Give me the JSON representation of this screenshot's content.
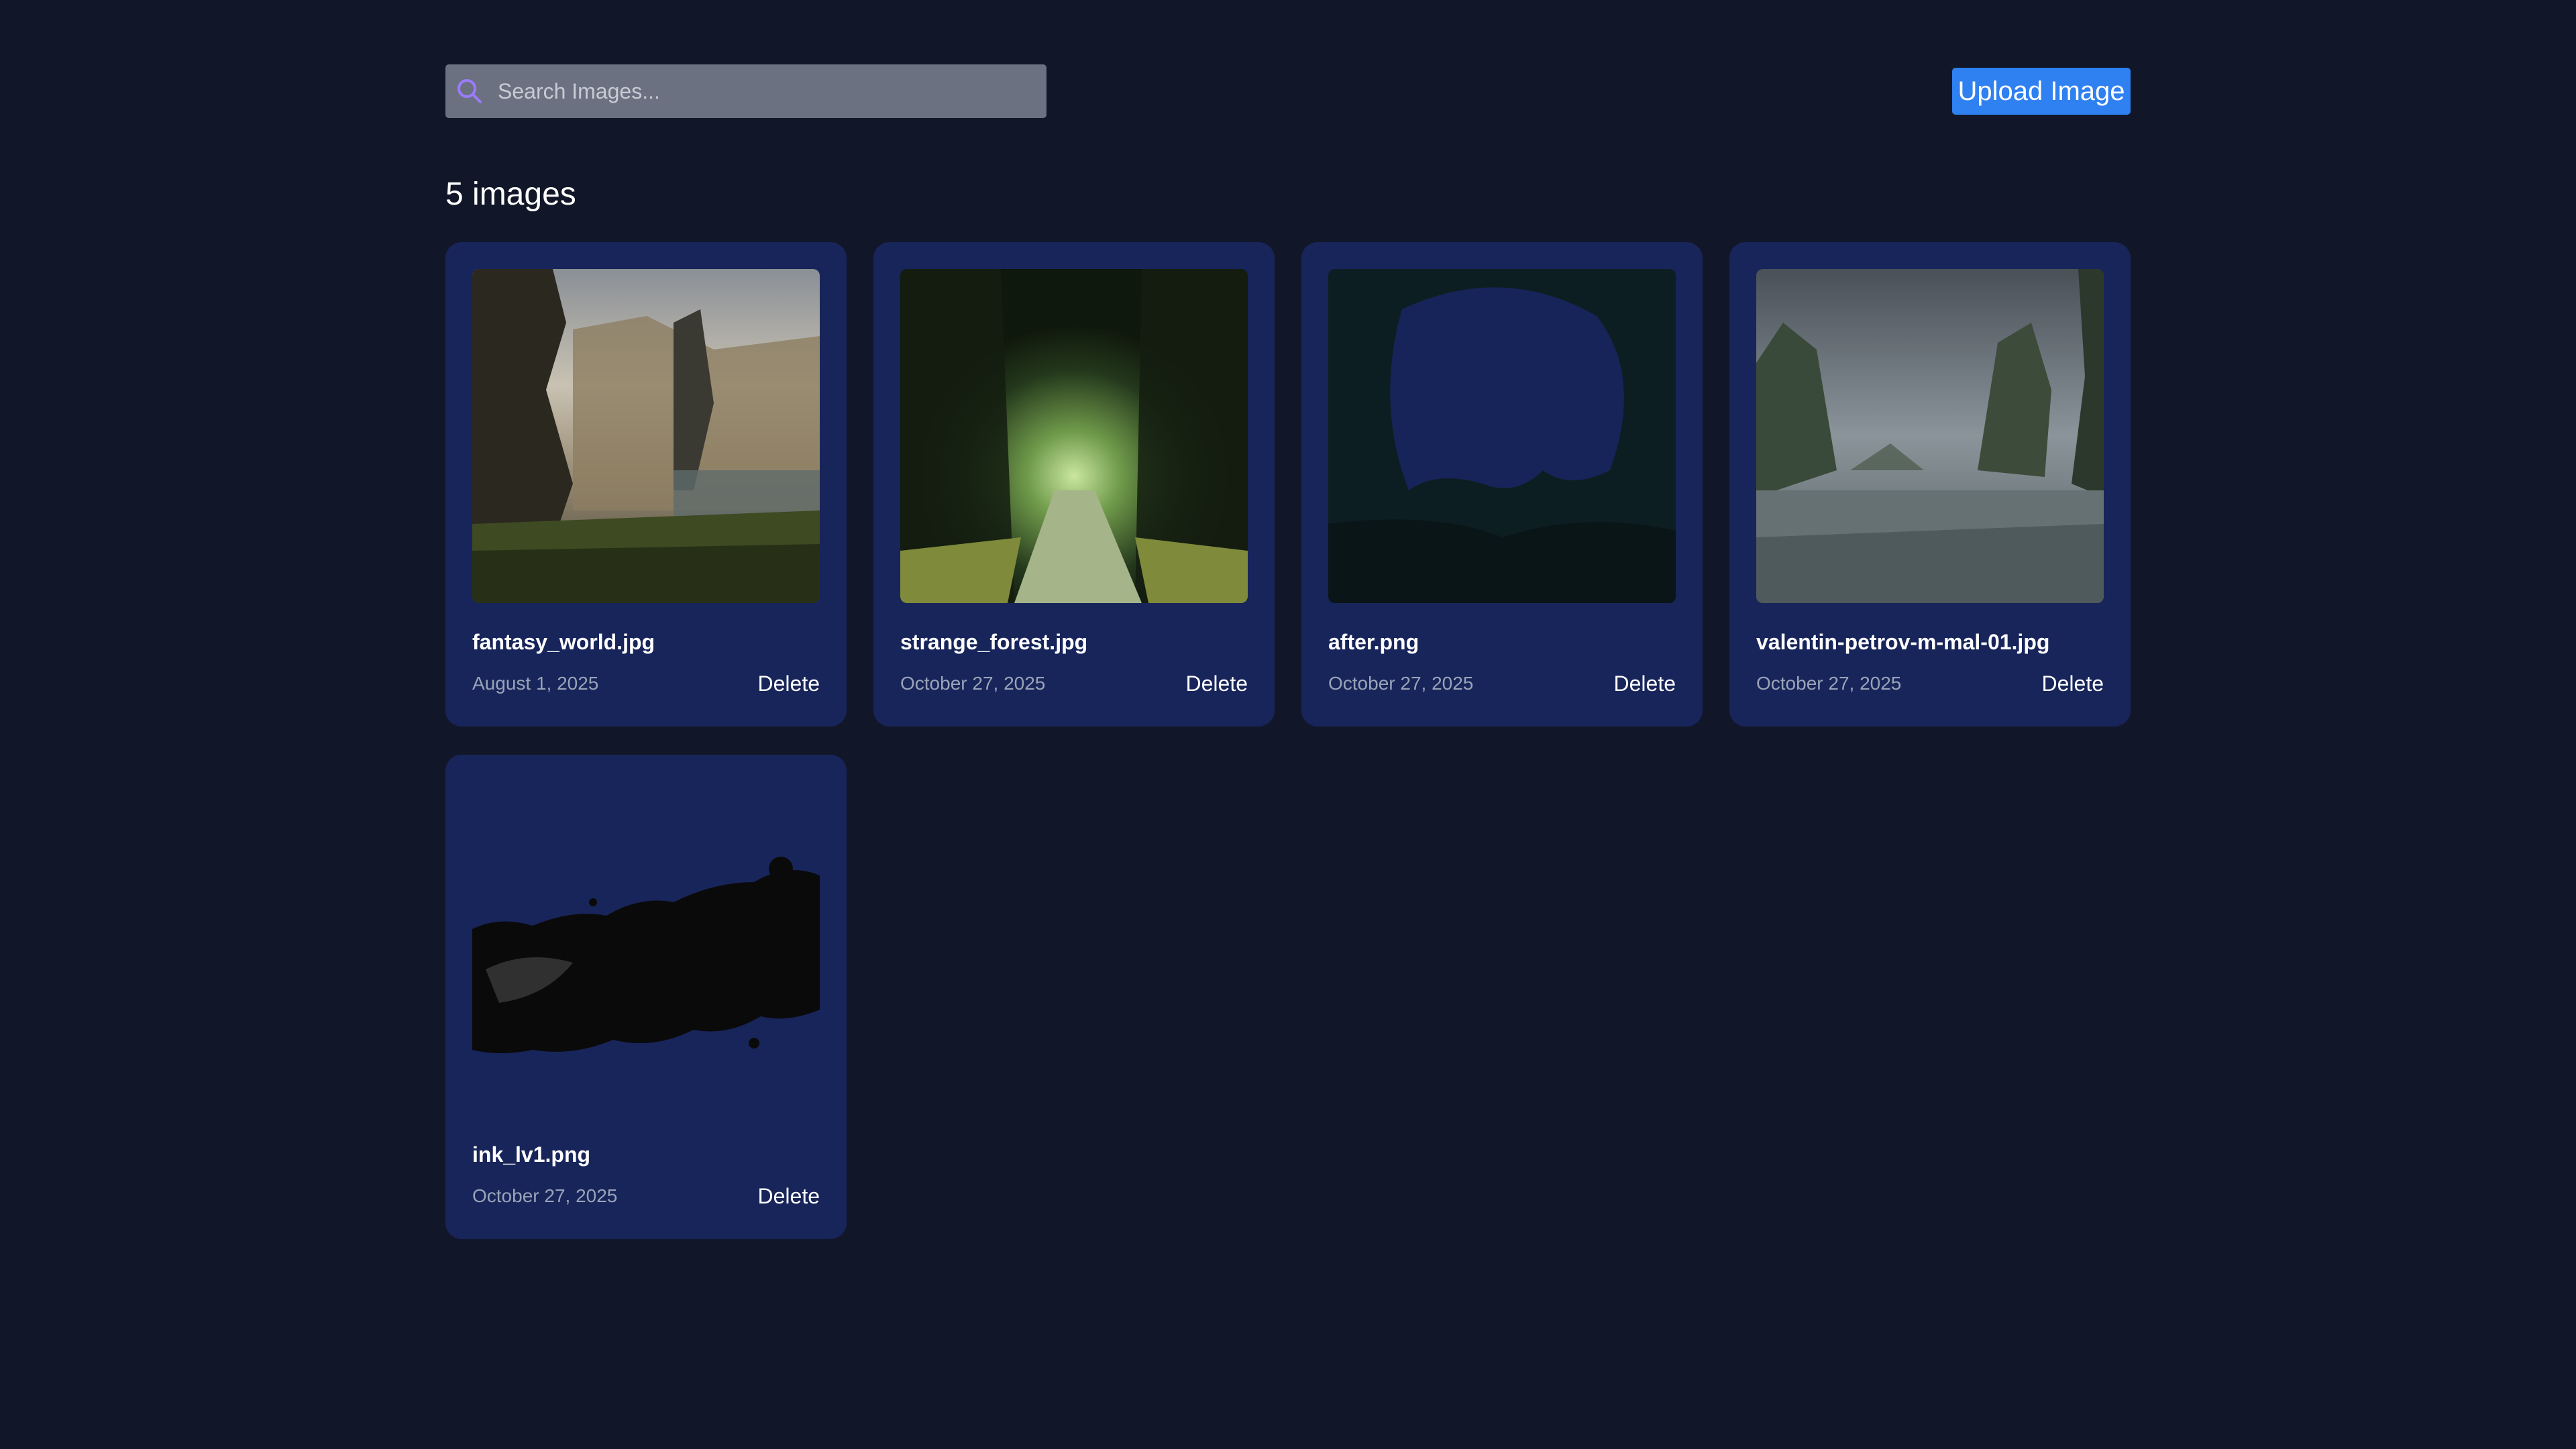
{
  "search": {
    "placeholder": "Search Images...",
    "value": "",
    "icon": "search-icon"
  },
  "upload_button": {
    "label": "Upload Image",
    "color": "#2f80f0"
  },
  "count_label": "5 images",
  "colors": {
    "background": "#111729",
    "card": "#18255a",
    "search_field": "#6b7180",
    "search_icon": "#9c7bff"
  },
  "images": [
    {
      "filename": "fantasy_world.jpg",
      "date": "August 1, 2025",
      "delete_label": "Delete"
    },
    {
      "filename": "strange_forest.jpg",
      "date": "October 27, 2025",
      "delete_label": "Delete"
    },
    {
      "filename": "after.png",
      "date": "October 27, 2025",
      "delete_label": "Delete"
    },
    {
      "filename": "valentin-petrov-m-mal-01.jpg",
      "date": "October 27, 2025",
      "delete_label": "Delete"
    },
    {
      "filename": "ink_lv1.png",
      "date": "October 27, 2025",
      "delete_label": "Delete"
    }
  ]
}
